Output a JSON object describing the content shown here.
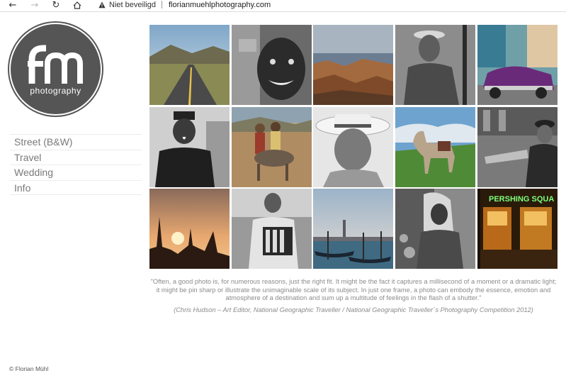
{
  "browser": {
    "security_label": "Niet beveiligd",
    "url": "florianmuehlphotography.com"
  },
  "logo": {
    "letters": "fm",
    "word": "photography"
  },
  "menu": {
    "items": [
      {
        "label": "Street (B&W)"
      },
      {
        "label": "Travel"
      },
      {
        "label": "Wedding"
      },
      {
        "label": "Info"
      }
    ]
  },
  "gallery": {
    "photos": [
      "road-landscape",
      "child-portrait-bw",
      "canyon",
      "old-man-bw",
      "purple-classic-car",
      "uniformed-man-bw",
      "donkey-riders",
      "woman-hat-bw",
      "horse-field",
      "street-scene-bw",
      "temple-sunset",
      "accordion-player-bw",
      "venice-gondolas",
      "woman-market-bw",
      "pershing-square-night"
    ],
    "sign_text": "PERSHING SQUA"
  },
  "quote": {
    "text": "\"Often, a good photo is, for numerous reasons, just the right fit. It might be the fact it captures a millisecond of a moment or a dramatic light; it might be pin sharp or illustrate the unimaginable scale of its subject. In just one frame, a photo can embody the essence, emotion and atmosphere of a destination and sum up a multitude of feelings in the flash of a shutter.\"",
    "credit": "(Chris Hudson – Art Editor, National Geographic Traveller / National Geographic Traveller´s Photography Competition 2012)"
  },
  "footer": {
    "copyright": "© Florian Mühl"
  },
  "colors": {
    "logo_bg": "#555555",
    "menu_text": "#7a7a7a",
    "quote_text": "#8b8b8b"
  }
}
